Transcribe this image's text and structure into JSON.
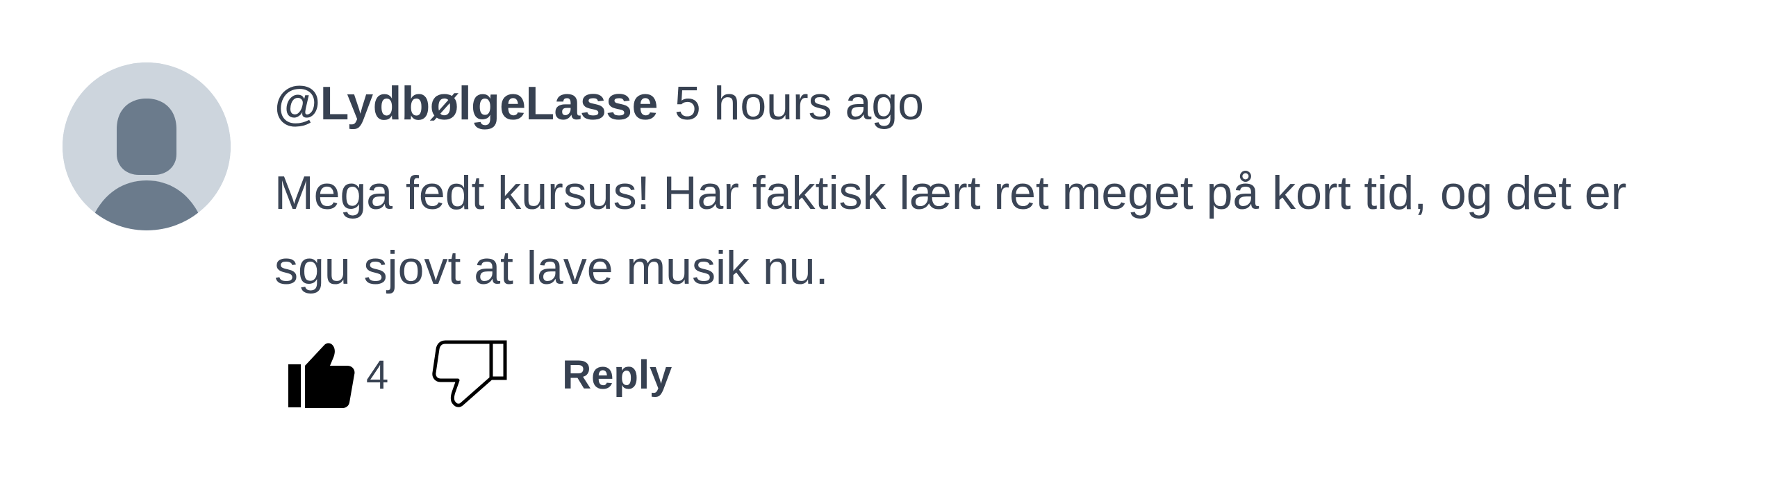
{
  "comment": {
    "author": "@LydbølgeLasse",
    "timestamp": "5 hours ago",
    "text": "Mega fedt kursus! Har faktisk lært ret meget på kort tid, og det er sgu sjovt at lave musik nu.",
    "like_count": "4",
    "reply_label": "Reply",
    "avatar_icon": "default-user-avatar-icon",
    "like_icon": "thumbs-up-filled-icon",
    "dislike_icon": "thumbs-down-outline-icon"
  },
  "colors": {
    "avatar_background": "#cdd5dd",
    "avatar_figure": "#6b7b8c",
    "text": "#374151"
  }
}
